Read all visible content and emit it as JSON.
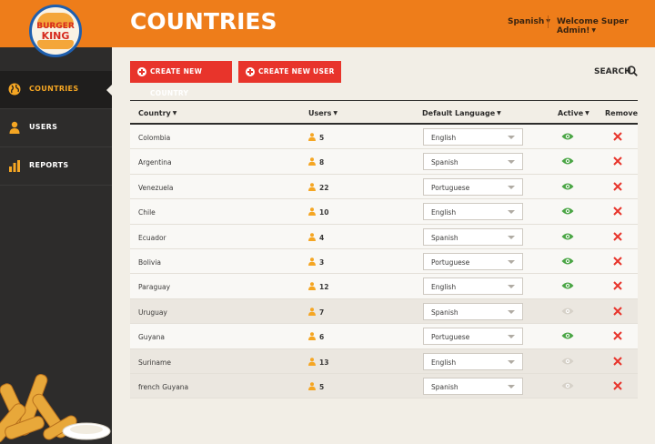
{
  "brand": {
    "logo_line1": "BURGER",
    "logo_line2": "KING",
    "accent": "#ee7d1a",
    "red": "#e8342b"
  },
  "header": {
    "title": "COUNTRIES",
    "language": "Spanish",
    "welcome": "Welcome Super Admin!"
  },
  "sidebar": {
    "items": [
      {
        "label": "COUNTRIES",
        "icon": "globe-icon",
        "active": true
      },
      {
        "label": "USERS",
        "icon": "user-icon",
        "active": false
      },
      {
        "label": "REPORTS",
        "icon": "bar-chart-icon",
        "active": false
      }
    ]
  },
  "actions": {
    "create_country": "CREATE NEW COUNTRY",
    "create_user": "CREATE NEW USER",
    "search": "SEARCH"
  },
  "table": {
    "headers": {
      "country": "Country",
      "users": "Users",
      "language": "Default Language",
      "active": "Active",
      "remove": "Remove"
    },
    "rows": [
      {
        "country": "Colombia",
        "users": "5",
        "language": "English",
        "active": true
      },
      {
        "country": "Argentina",
        "users": "8",
        "language": "Spanish",
        "active": true
      },
      {
        "country": "Venezuela",
        "users": "22",
        "language": "Portuguese",
        "active": true
      },
      {
        "country": "Chile",
        "users": "10",
        "language": "English",
        "active": true
      },
      {
        "country": "Ecuador",
        "users": "4",
        "language": "Spanish",
        "active": true
      },
      {
        "country": "Bolivia",
        "users": "3",
        "language": "Portuguese",
        "active": true
      },
      {
        "country": "Paraguay",
        "users": "12",
        "language": "English",
        "active": true
      },
      {
        "country": "Uruguay",
        "users": "7",
        "language": "Spanish",
        "active": false
      },
      {
        "country": "Guyana",
        "users": "6",
        "language": "Portuguese",
        "active": true
      },
      {
        "country": "Suriname",
        "users": "13",
        "language": "English",
        "active": false
      },
      {
        "country": "french Guyana",
        "users": "5",
        "language": "Spanish",
        "active": false
      }
    ]
  }
}
